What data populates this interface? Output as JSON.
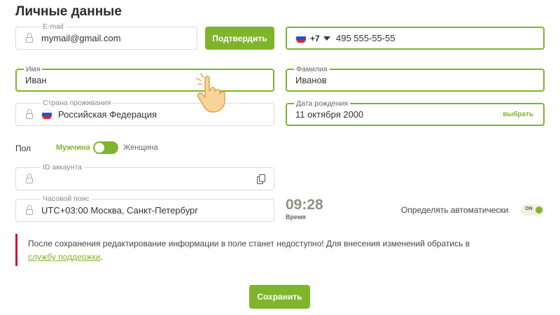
{
  "page": {
    "title": "Личные данные"
  },
  "email": {
    "label": "E-mail",
    "value": "mymail@gmail.com",
    "confirm_button": "Подтвердить"
  },
  "phone": {
    "code": "+7",
    "value": "495 555-55-55",
    "flag_icon": "russia-flag-icon"
  },
  "first_name": {
    "label": "Имя",
    "value": "Иван"
  },
  "last_name": {
    "label": "Фамилия",
    "value": "Иванов"
  },
  "country": {
    "label": "Страна проживания",
    "value": "Российская Федерация"
  },
  "birth_date": {
    "label": "Дата рождения",
    "value": "11 октября 2000",
    "pick_label": "выбрать"
  },
  "gender": {
    "label": "Пол",
    "male": "Мужчина",
    "female": "Женщина",
    "selected": "male"
  },
  "account_id": {
    "label": "ID аккаунта",
    "value": ""
  },
  "timezone": {
    "label": "Часовой пояс",
    "value": "UTC+03:00 Москва, Санкт-Петербург",
    "time": "09:28",
    "time_label": "Время",
    "auto_label": "Определять автоматически",
    "auto_state": "ON"
  },
  "notice": {
    "text": "После сохранения редактирование информации в поле станет недоступно! Для внесения изменений обратись в",
    "link": "службу поддержки",
    "end": "."
  },
  "save_button": "Сохранить",
  "colors": {
    "accent": "#7fb52a",
    "alert_bar": "#c9163a",
    "border": "#d8dcd6"
  }
}
